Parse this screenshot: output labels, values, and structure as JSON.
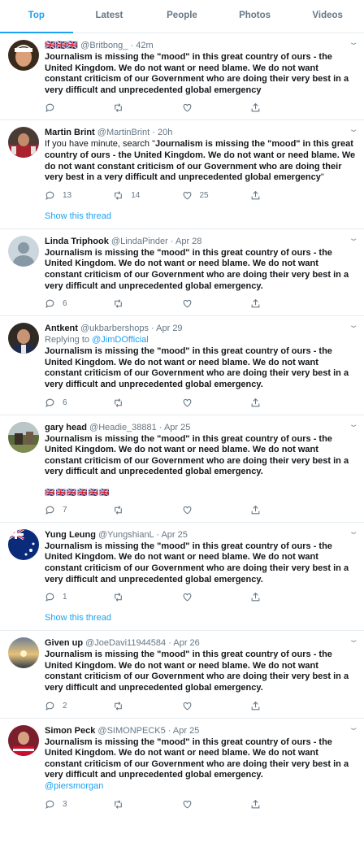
{
  "tabs": [
    {
      "label": "Top",
      "active": true
    },
    {
      "label": "Latest",
      "active": false
    },
    {
      "label": "People",
      "active": false
    },
    {
      "label": "Photos",
      "active": false
    },
    {
      "label": "Videos",
      "active": false
    }
  ],
  "tweets": [
    {
      "name": "🇬🇧🇬🇧🇬🇧",
      "handle": "@Britbong_",
      "time": "42m",
      "text": "Journalism is missing the \"mood\" in this great country of ours - the United Kingdom. We do not want or need blame. We do not want constant criticism of our Government who are doing their very best in a very difficult and unprecedented global emergency",
      "replies": "",
      "retweets": "",
      "likes": ""
    },
    {
      "name": "Martin Brint",
      "handle": "@MartinBrint",
      "time": "20h",
      "text_prefix": "If you have minute, search \"",
      "text": "Journalism is missing the \"mood\" in this great country of ours - the United Kingdom. We do not want or need blame. We do not want constant criticism of our Government who are doing their very best in a very difficult and unprecedented global emergency",
      "text_suffix": "\"",
      "replies": "13",
      "retweets": "14",
      "likes": "25",
      "thread": "Show this thread"
    },
    {
      "name": "Linda Triphook",
      "handle": "@LindaPinder",
      "time": "Apr 28",
      "text": "Journalism is missing the \"mood\" in this great country of ours - the United Kingdom. We do not want or need blame. We do not want constant criticism of our Government who are doing their very best in a very difficult and unprecedented global emergency.",
      "replies": "6",
      "retweets": "",
      "likes": ""
    },
    {
      "name": "Antkent",
      "handle": "@ukbarbershops",
      "time": "Apr 29",
      "reply_prefix": "Replying to",
      "reply_to": "@JimDOfficial",
      "text": "Journalism is missing the \"mood\" in this great country of ours - the United Kingdom. We do not want or need blame. We do not want constant criticism of our Government who are doing their very best in a very difficult and unprecedented global emergency.",
      "replies": "6",
      "retweets": "",
      "likes": ""
    },
    {
      "name": "gary head",
      "handle": "@Headie_38881",
      "time": "Apr 25",
      "text": "Journalism is missing the \"mood\" in this great country of ours - the United Kingdom. We do not want or need blame. We do not want constant criticism of our Government who are doing their very best in a very difficult and unprecedented global emergency.",
      "extra": "🇬🇧🇬🇧🇬🇧🇬🇧🇬🇧🇬🇧",
      "replies": "7",
      "retweets": "",
      "likes": ""
    },
    {
      "name": "Yung Leung",
      "handle": "@YungshianL",
      "time": "Apr 25",
      "text": "Journalism is missing the \"mood\" in this great country of ours - the United Kingdom. We do not want or need blame. We do not want constant criticism of our Government who are doing their very best in a very difficult and unprecedented global emergency.",
      "replies": "1",
      "retweets": "",
      "likes": "",
      "thread": "Show this thread"
    },
    {
      "name": "Given up",
      "handle": "@JoeDavi11944584",
      "time": "Apr 26",
      "text": "Journalism is missing the \"mood\" in this great country of ours - the United Kingdom. We do not want or need blame. We do not want constant criticism of our Government who are doing their very best in a very difficult and unprecedented global emergency.",
      "replies": "2",
      "retweets": "",
      "likes": ""
    },
    {
      "name": "Simon Peck",
      "handle": "@SIMONPECK5",
      "time": "Apr 25",
      "text": "Journalism is missing the \"mood\" in this great country of ours - the United Kingdom. We do not want or need blame. We do not want constant criticism of our Government who are doing their very best in a very difficult and unprecedented global emergency.",
      "mention": "@piersmorgan",
      "replies": "3",
      "retweets": "",
      "likes": ""
    }
  ],
  "icons": {
    "reply": "reply-icon",
    "retweet": "retweet-icon",
    "like": "heart-icon",
    "share": "share-icon",
    "menu": "chevron-down-icon"
  },
  "colors": {
    "accent": "#1da1f2",
    "secondary_text": "#657786",
    "divider": "#e6ecf0"
  }
}
